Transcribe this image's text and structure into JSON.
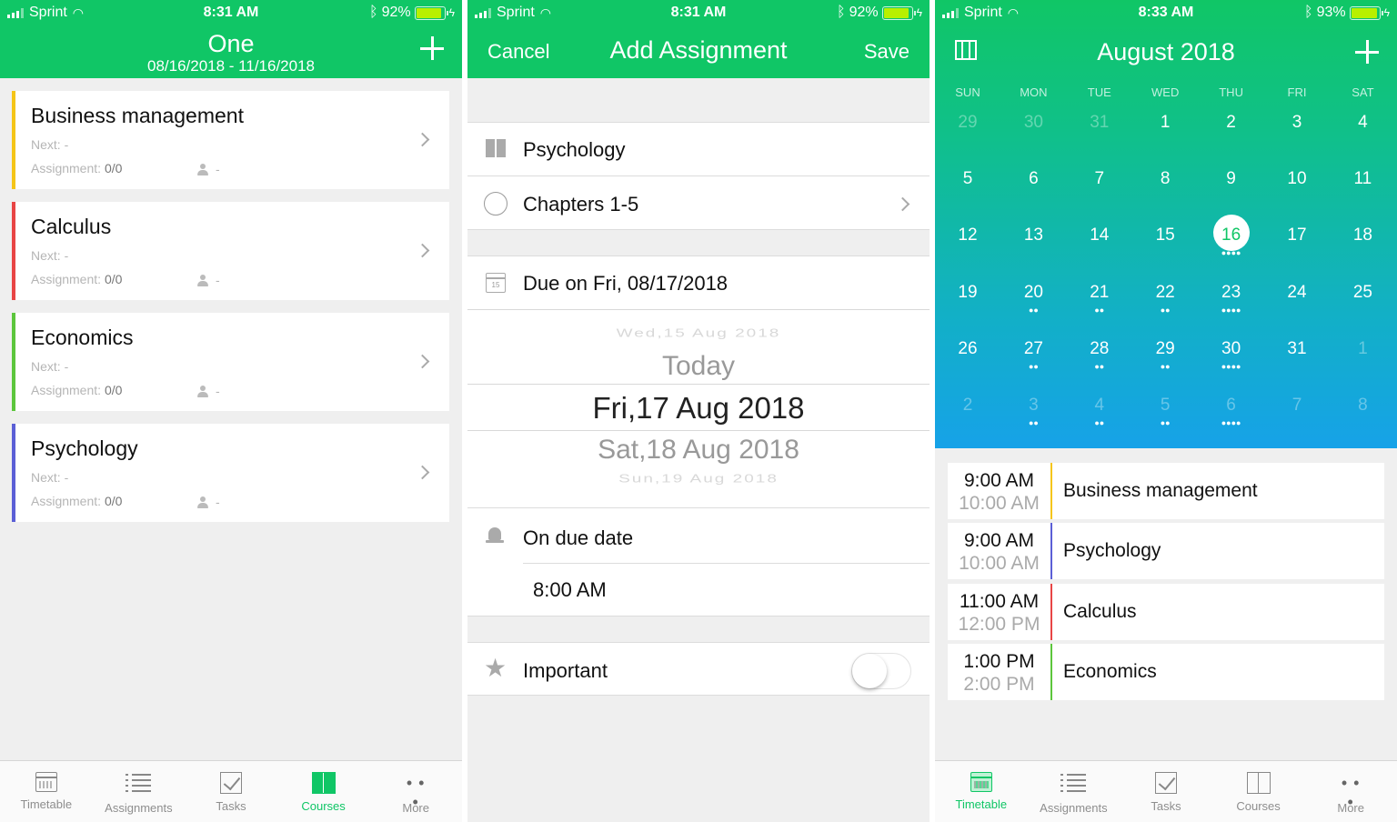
{
  "colors": {
    "accent": "#10c666",
    "business": "#f5c518",
    "calculus": "#e84545",
    "economics": "#5cc63c",
    "psychology": "#5b5fd6"
  },
  "panel1": {
    "status": {
      "carrier": "Sprint",
      "time": "8:31 AM",
      "battery": "92%"
    },
    "title": "One",
    "subtitle": "08/16/2018 - 11/16/2018",
    "courses": [
      {
        "name": "Business management",
        "next": "Next: -",
        "assignment_label": "Assignment: ",
        "assignment_value": "0/0",
        "teacher": "-"
      },
      {
        "name": "Calculus",
        "next": "Next: -",
        "assignment_label": "Assignment: ",
        "assignment_value": "0/0",
        "teacher": "-"
      },
      {
        "name": "Economics",
        "next": "Next: -",
        "assignment_label": "Assignment: ",
        "assignment_value": "0/0",
        "teacher": "-"
      },
      {
        "name": "Psychology",
        "next": "Next: -",
        "assignment_label": "Assignment: ",
        "assignment_value": "0/0",
        "teacher": "-"
      }
    ]
  },
  "panel2": {
    "status": {
      "carrier": "Sprint",
      "time": "8:31 AM",
      "battery": "92%"
    },
    "cancel": "Cancel",
    "title": "Add Assignment",
    "save": "Save",
    "course": "Psychology",
    "assignment_name": "Chapters 1-5",
    "due": "Due on Fri, 08/17/2018",
    "cal_icon_day": "15",
    "picker": [
      "Wed,15 Aug 2018",
      "Today",
      "Fri,17 Aug 2018",
      "Sat,18 Aug 2018",
      "Sun,19 Aug 2018"
    ],
    "reminder": "On due date",
    "reminder_time": "8:00 AM",
    "important": "Important",
    "important_on": false
  },
  "panel3": {
    "status": {
      "carrier": "Sprint",
      "time": "8:33 AM",
      "battery": "93%"
    },
    "title": "August 2018",
    "weekdays": [
      "SUN",
      "MON",
      "TUE",
      "WED",
      "THU",
      "FRI",
      "SAT"
    ],
    "weeks": [
      [
        {
          "d": "29",
          "dim": true
        },
        {
          "d": "30",
          "dim": true
        },
        {
          "d": "31",
          "dim": true
        },
        {
          "d": "1"
        },
        {
          "d": "2"
        },
        {
          "d": "3"
        },
        {
          "d": "4"
        }
      ],
      [
        {
          "d": "5"
        },
        {
          "d": "6"
        },
        {
          "d": "7"
        },
        {
          "d": "8"
        },
        {
          "d": "9"
        },
        {
          "d": "10"
        },
        {
          "d": "11"
        }
      ],
      [
        {
          "d": "12"
        },
        {
          "d": "13"
        },
        {
          "d": "14"
        },
        {
          "d": "15"
        },
        {
          "d": "16",
          "today": true,
          "dots": 4
        },
        {
          "d": "17"
        },
        {
          "d": "18"
        }
      ],
      [
        {
          "d": "19"
        },
        {
          "d": "20",
          "dots": 2
        },
        {
          "d": "21",
          "dots": 2
        },
        {
          "d": "22",
          "dots": 2
        },
        {
          "d": "23",
          "dots": 4
        },
        {
          "d": "24"
        },
        {
          "d": "25"
        }
      ],
      [
        {
          "d": "26"
        },
        {
          "d": "27",
          "dots": 2
        },
        {
          "d": "28",
          "dots": 2
        },
        {
          "d": "29",
          "dots": 2
        },
        {
          "d": "30",
          "dots": 4
        },
        {
          "d": "31"
        },
        {
          "d": "1",
          "dim": true
        }
      ],
      [
        {
          "d": "2",
          "dim": true
        },
        {
          "d": "3",
          "dim": true,
          "dots": 2
        },
        {
          "d": "4",
          "dim": true,
          "dots": 2
        },
        {
          "d": "5",
          "dim": true,
          "dots": 2
        },
        {
          "d": "6",
          "dim": true,
          "dots": 4
        },
        {
          "d": "7",
          "dim": true
        },
        {
          "d": "8",
          "dim": true
        }
      ]
    ],
    "events": [
      {
        "start": "9:00 AM",
        "end": "10:00 AM",
        "name": "Business management",
        "color": "#f5c518"
      },
      {
        "start": "9:00 AM",
        "end": "10:00 AM",
        "name": "Psychology",
        "color": "#5b5fd6"
      },
      {
        "start": "11:00 AM",
        "end": "12:00 PM",
        "name": "Calculus",
        "color": "#e84545"
      },
      {
        "start": "1:00 PM",
        "end": "2:00 PM",
        "name": "Economics",
        "color": "#5cc63c"
      }
    ]
  },
  "tabs": [
    {
      "label": "Timetable",
      "icon": "timetable-icon"
    },
    {
      "label": "Assignments",
      "icon": "list-icon"
    },
    {
      "label": "Tasks",
      "icon": "tasks-icon"
    },
    {
      "label": "Courses",
      "icon": "book-icon"
    },
    {
      "label": "More",
      "icon": "more-icon"
    }
  ]
}
